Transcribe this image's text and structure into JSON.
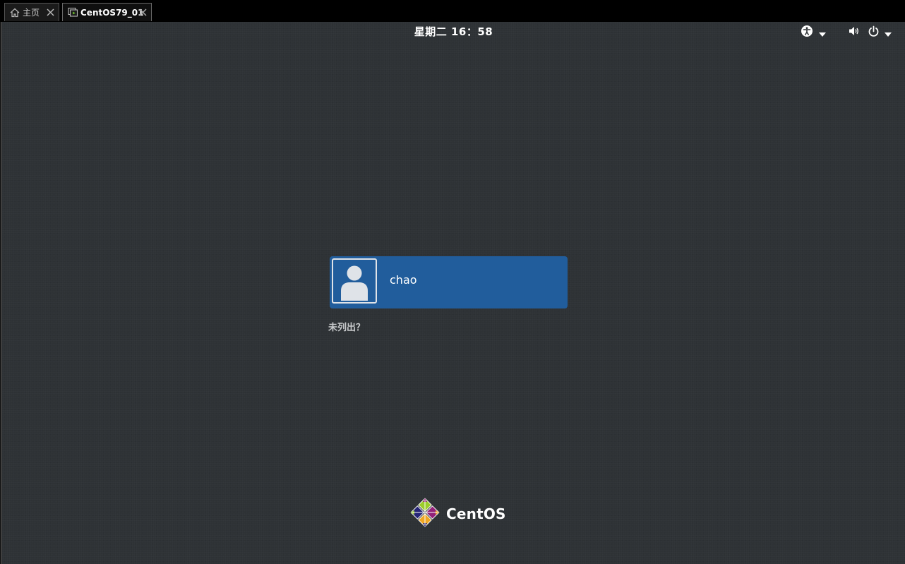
{
  "tabs": [
    {
      "label": "主页",
      "icon": "home-icon",
      "active": false
    },
    {
      "label": "CentOS79_01",
      "icon": "vm-icon",
      "active": true
    }
  ],
  "topbar": {
    "clock": "星期二 16：58",
    "icons": [
      "accessibility-icon",
      "volume-icon",
      "power-icon"
    ]
  },
  "login": {
    "users": [
      {
        "name": "chao",
        "avatar": "user-avatar-icon"
      }
    ],
    "not_listed_label": "未列出？"
  },
  "branding": {
    "logo_text": "CentOS",
    "logo_colors": [
      "#9ccd2a",
      "#932279",
      "#efa724",
      "#262577"
    ]
  },
  "colors": {
    "background": "#2e3235",
    "selected_user": "#215d9c",
    "text": "#ffffff"
  }
}
